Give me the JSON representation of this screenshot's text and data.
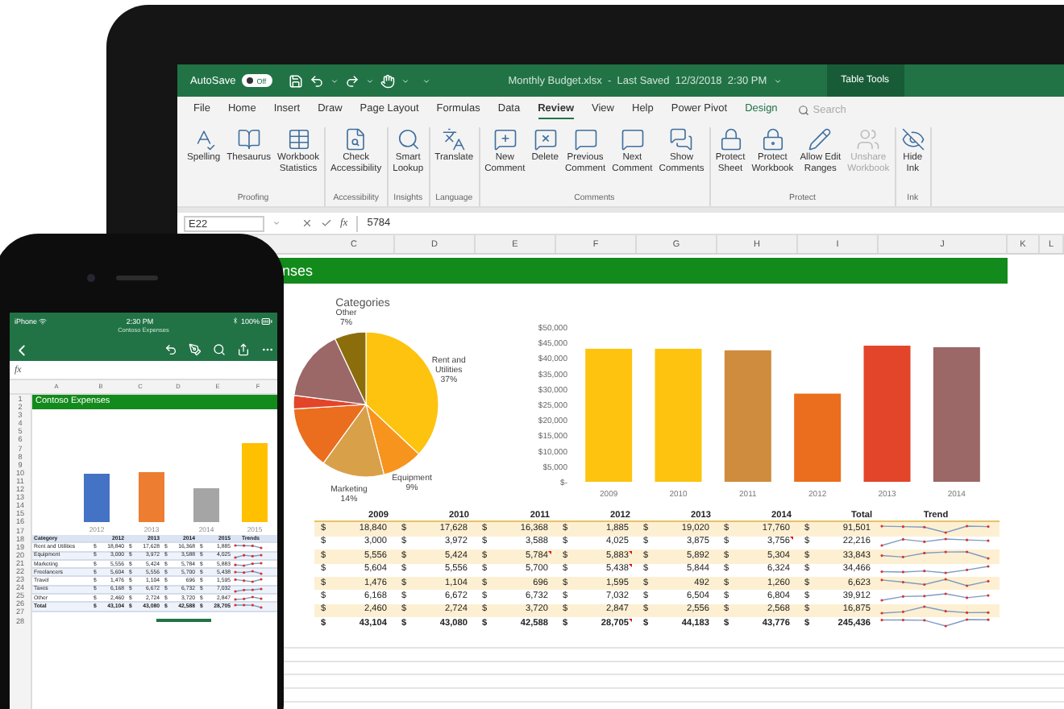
{
  "tablet": {
    "title_bar": {
      "autosave_label": "AutoSave",
      "autosave_on": false,
      "autosave_state": "Off",
      "document": "Monthly Budget.xlsx  -  Last Saved  12/3/2018  2:30 PM",
      "context_label": "Table Tools"
    },
    "tabs": [
      {
        "label": "File",
        "selected": false,
        "kind": "normal"
      },
      {
        "label": "Home",
        "selected": false,
        "kind": "normal"
      },
      {
        "label": "Insert",
        "selected": false,
        "kind": "normal"
      },
      {
        "label": "Draw",
        "selected": false,
        "kind": "normal"
      },
      {
        "label": "Page Layout",
        "selected": false,
        "kind": "normal"
      },
      {
        "label": "Formulas",
        "selected": false,
        "kind": "normal"
      },
      {
        "label": "Data",
        "selected": false,
        "kind": "normal"
      },
      {
        "label": "Review",
        "selected": true,
        "kind": "normal"
      },
      {
        "label": "View",
        "selected": false,
        "kind": "normal"
      },
      {
        "label": "Help",
        "selected": false,
        "kind": "normal"
      },
      {
        "label": "Power Pivot",
        "selected": false,
        "kind": "normal"
      },
      {
        "label": "Design",
        "selected": false,
        "kind": "contextual"
      }
    ],
    "search": {
      "placeholder": "Search"
    },
    "ribbon_groups": [
      {
        "label": "Proofing",
        "buttons": [
          {
            "label": "Spelling",
            "disabled": false
          },
          {
            "label": "Thesaurus",
            "disabled": false
          },
          {
            "label": "Workbook\nStatistics",
            "disabled": false
          }
        ]
      },
      {
        "label": "Accessibility",
        "buttons": [
          {
            "label": "Check\nAccessibility",
            "disabled": false
          }
        ]
      },
      {
        "label": "Insights",
        "buttons": [
          {
            "label": "Smart\nLookup",
            "disabled": false
          }
        ]
      },
      {
        "label": "Language",
        "buttons": [
          {
            "label": "Translate",
            "disabled": false
          }
        ]
      },
      {
        "label": "Comments",
        "buttons": [
          {
            "label": "New\nComment",
            "disabled": false
          },
          {
            "label": "Delete",
            "disabled": false
          },
          {
            "label": "Previous\nComment",
            "disabled": false
          },
          {
            "label": "Next\nComment",
            "disabled": false
          },
          {
            "label": "Show\nComments",
            "disabled": false
          }
        ]
      },
      {
        "label": "Protect",
        "buttons": [
          {
            "label": "Protect\nSheet",
            "disabled": false
          },
          {
            "label": "Protect\nWorkbook",
            "disabled": false
          },
          {
            "label": "Allow Edit\nRanges",
            "disabled": false
          },
          {
            "label": "Unshare\nWorkbook",
            "disabled": true
          }
        ]
      },
      {
        "label": "Ink",
        "buttons": [
          {
            "label": "Hide\nInk",
            "disabled": false
          }
        ]
      }
    ],
    "name_box": "E22",
    "fx_label": "fx",
    "formula": "5784",
    "columns": [
      "C",
      "D",
      "E",
      "F",
      "G",
      "H",
      "I",
      "J",
      "K",
      "L"
    ],
    "sheet_title": "nses",
    "pie_chart": {
      "chart_data": {
        "type": "pie",
        "title": "Categories",
        "categories": [
          "Rent and\nUtilities",
          "Equipment",
          "Marketing",
          null,
          null,
          null,
          "Other"
        ],
        "values": [
          37,
          9,
          14,
          14,
          3,
          16,
          7
        ],
        "value_labels": [
          "37%",
          "9%",
          "14%",
          null,
          null,
          null,
          "7%"
        ],
        "colors": [
          "#fdc30f",
          "#f7941d",
          "#d9a04a",
          "#ea6e1d",
          "#e2452a",
          "#9b6767",
          "#8c6d0c"
        ]
      }
    },
    "bar_chart": {
      "chart_data": {
        "type": "bar",
        "categories": [
          "2009",
          "2010",
          "2011",
          "2012",
          "2013",
          "2014"
        ],
        "series": [
          {
            "colors": [
              "#fdc30f",
              "#fdc30f",
              "#cf8b3e",
              "#ea6e1d",
              "#e2452a",
              "#9b6767"
            ],
            "values": [
              43000,
              43000,
              42500,
              28500,
              44000,
              43500
            ]
          }
        ],
        "ylim": [
          0,
          50000
        ],
        "yticks": [
          {
            "value": 0,
            "label": "$-"
          },
          {
            "value": 5000,
            "label": "$5,000"
          },
          {
            "value": 10000,
            "label": "$10,000"
          },
          {
            "value": 15000,
            "label": "$15,000"
          },
          {
            "value": 20000,
            "label": "$20,000"
          },
          {
            "value": 25000,
            "label": "$25,000"
          },
          {
            "value": 30000,
            "label": "$30,000"
          },
          {
            "value": 35000,
            "label": "$35,000"
          },
          {
            "value": 40000,
            "label": "$40,000"
          },
          {
            "value": 45000,
            "label": "$45,000"
          },
          {
            "value": 50000,
            "label": "$50,000"
          }
        ]
      }
    },
    "table": {
      "columns": [
        "2009",
        "2010",
        "2011",
        "2012",
        "2013",
        "2014",
        "Total",
        "Trend"
      ],
      "rows": [
        {
          "kind": "data",
          "cells": [
            {
              "sym": "$",
              "v": "18,840",
              "comment": false
            },
            {
              "sym": "$",
              "v": "17,628",
              "comment": false
            },
            {
              "sym": "$",
              "v": "16,368",
              "comment": false
            },
            {
              "sym": "$",
              "v": "1,885",
              "comment": false
            },
            {
              "sym": "$",
              "v": "19,020",
              "comment": false
            },
            {
              "sym": "$",
              "v": "17,760",
              "comment": false
            },
            {
              "sym": "$",
              "v": "91,501",
              "comment": false
            }
          ]
        },
        {
          "kind": "data",
          "cells": [
            {
              "sym": "$",
              "v": "3,000",
              "comment": false
            },
            {
              "sym": "$",
              "v": "3,972",
              "comment": false
            },
            {
              "sym": "$",
              "v": "3,588",
              "comment": false
            },
            {
              "sym": "$",
              "v": "4,025",
              "comment": false
            },
            {
              "sym": "$",
              "v": "3,875",
              "comment": false
            },
            {
              "sym": "$",
              "v": "3,756",
              "comment": true
            },
            {
              "sym": "$",
              "v": "22,216",
              "comment": false
            }
          ]
        },
        {
          "kind": "data",
          "cells": [
            {
              "sym": "$",
              "v": "5,556",
              "comment": false
            },
            {
              "sym": "$",
              "v": "5,424",
              "comment": false
            },
            {
              "sym": "$",
              "v": "5,784",
              "comment": true
            },
            {
              "sym": "$",
              "v": "5,883",
              "comment": true
            },
            {
              "sym": "$",
              "v": "5,892",
              "comment": false
            },
            {
              "sym": "$",
              "v": "5,304",
              "comment": false
            },
            {
              "sym": "$",
              "v": "33,843",
              "comment": false
            }
          ]
        },
        {
          "kind": "data",
          "cells": [
            {
              "sym": "$",
              "v": "5,604",
              "comment": false
            },
            {
              "sym": "$",
              "v": "5,556",
              "comment": false
            },
            {
              "sym": "$",
              "v": "5,700",
              "comment": false
            },
            {
              "sym": "$",
              "v": "5,438",
              "comment": true
            },
            {
              "sym": "$",
              "v": "5,844",
              "comment": false
            },
            {
              "sym": "$",
              "v": "6,324",
              "comment": false
            },
            {
              "sym": "$",
              "v": "34,466",
              "comment": false
            }
          ]
        },
        {
          "kind": "data",
          "cells": [
            {
              "sym": "$",
              "v": "1,476",
              "comment": false
            },
            {
              "sym": "$",
              "v": "1,104",
              "comment": false
            },
            {
              "sym": "$",
              "v": "696",
              "comment": false
            },
            {
              "sym": "$",
              "v": "1,595",
              "comment": false
            },
            {
              "sym": "$",
              "v": "492",
              "comment": false
            },
            {
              "sym": "$",
              "v": "1,260",
              "comment": false
            },
            {
              "sym": "$",
              "v": "6,623",
              "comment": false
            }
          ]
        },
        {
          "kind": "data",
          "cells": [
            {
              "sym": "$",
              "v": "6,168",
              "comment": false
            },
            {
              "sym": "$",
              "v": "6,672",
              "comment": false
            },
            {
              "sym": "$",
              "v": "6,732",
              "comment": false
            },
            {
              "sym": "$",
              "v": "7,032",
              "comment": false
            },
            {
              "sym": "$",
              "v": "6,504",
              "comment": false
            },
            {
              "sym": "$",
              "v": "6,804",
              "comment": false
            },
            {
              "sym": "$",
              "v": "39,912",
              "comment": false
            }
          ]
        },
        {
          "kind": "data",
          "cells": [
            {
              "sym": "$",
              "v": "2,460",
              "comment": false
            },
            {
              "sym": "$",
              "v": "2,724",
              "comment": false
            },
            {
              "sym": "$",
              "v": "3,720",
              "comment": false
            },
            {
              "sym": "$",
              "v": "2,847",
              "comment": false
            },
            {
              "sym": "$",
              "v": "2,556",
              "comment": false
            },
            {
              "sym": "$",
              "v": "2,568",
              "comment": false
            },
            {
              "sym": "$",
              "v": "16,875",
              "comment": false
            }
          ]
        },
        {
          "kind": "total",
          "cells": [
            {
              "sym": "$",
              "v": "43,104",
              "comment": false
            },
            {
              "sym": "$",
              "v": "43,080",
              "comment": false
            },
            {
              "sym": "$",
              "v": "42,588",
              "comment": false
            },
            {
              "sym": "$",
              "v": "28,705",
              "comment": true
            },
            {
              "sym": "$",
              "v": "44,183",
              "comment": false
            },
            {
              "sym": "$",
              "v": "43,776",
              "comment": false
            },
            {
              "sym": "$",
              "v": "245,436",
              "comment": false
            }
          ]
        }
      ]
    }
  },
  "phone": {
    "status": {
      "carrier": "iPhone",
      "time": "2:30 PM",
      "battery": "100%",
      "document": "Contoso Expenses"
    },
    "fx_label": "fx",
    "columns": [
      "A",
      "B",
      "C",
      "D",
      "E",
      "F"
    ],
    "row_numbers": [
      "1",
      "2",
      "3",
      "4",
      "5",
      "6",
      "7",
      "8",
      "9",
      "10",
      "11",
      "12",
      "13",
      "14",
      "15",
      "16",
      "17",
      "18",
      "19",
      "20",
      "21",
      "22",
      "23",
      "24",
      "25",
      "26",
      "27",
      "28"
    ],
    "sheet_title": "Contoso Expenses",
    "chart_labels": [
      "2012",
      "2013",
      "2014",
      "2015"
    ],
    "table": {
      "columns": [
        "Category",
        "2012",
        "2013",
        "2014",
        "2015",
        "Trends"
      ],
      "rows": [
        {
          "kind": "data",
          "cells": [
            {
              "v": "Rent and Utilities"
            },
            {
              "sym": "$",
              "v": "18,840"
            },
            {
              "sym": "$",
              "v": "17,628"
            },
            {
              "sym": "$",
              "v": "16,368"
            },
            {
              "sym": "$",
              "v": "1,885"
            }
          ]
        },
        {
          "kind": "data",
          "cells": [
            {
              "v": "Equipment"
            },
            {
              "sym": "$",
              "v": "3,000"
            },
            {
              "sym": "$",
              "v": "3,972"
            },
            {
              "sym": "$",
              "v": "3,588"
            },
            {
              "sym": "$",
              "v": "4,025"
            }
          ]
        },
        {
          "kind": "data",
          "cells": [
            {
              "v": "Marketing"
            },
            {
              "sym": "$",
              "v": "5,556"
            },
            {
              "sym": "$",
              "v": "5,424"
            },
            {
              "sym": "$",
              "v": "5,784"
            },
            {
              "sym": "$",
              "v": "5,883"
            }
          ]
        },
        {
          "kind": "data",
          "cells": [
            {
              "v": "Freelancers"
            },
            {
              "sym": "$",
              "v": "5,604"
            },
            {
              "sym": "$",
              "v": "5,556"
            },
            {
              "sym": "$",
              "v": "5,700"
            },
            {
              "sym": "$",
              "v": "5,438"
            }
          ]
        },
        {
          "kind": "data",
          "cells": [
            {
              "v": "Travel"
            },
            {
              "sym": "$",
              "v": "1,476"
            },
            {
              "sym": "$",
              "v": "1,104"
            },
            {
              "sym": "$",
              "v": "696"
            },
            {
              "sym": "$",
              "v": "1,595"
            }
          ]
        },
        {
          "kind": "data",
          "cells": [
            {
              "v": "Taxes"
            },
            {
              "sym": "$",
              "v": "6,168"
            },
            {
              "sym": "$",
              "v": "6,672"
            },
            {
              "sym": "$",
              "v": "6,732"
            },
            {
              "sym": "$",
              "v": "7,032"
            }
          ]
        },
        {
          "kind": "data",
          "cells": [
            {
              "v": "Other"
            },
            {
              "sym": "$",
              "v": "2,460"
            },
            {
              "sym": "$",
              "v": "2,724"
            },
            {
              "sym": "$",
              "v": "3,720"
            },
            {
              "sym": "$",
              "v": "2,847"
            }
          ]
        },
        {
          "kind": "total",
          "cells": [
            {
              "v": "Total"
            },
            {
              "sym": "$",
              "v": "43,104"
            },
            {
              "sym": "$",
              "v": "43,080"
            },
            {
              "sym": "$",
              "v": "42,588"
            },
            {
              "sym": "$",
              "v": "28,705"
            }
          ]
        }
      ]
    }
  }
}
